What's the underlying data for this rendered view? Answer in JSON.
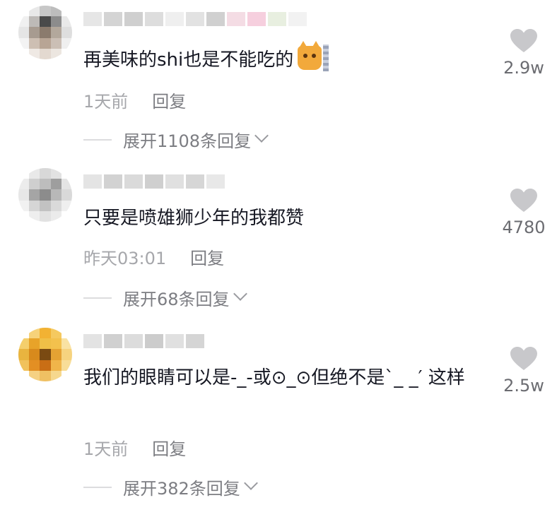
{
  "colors": {
    "text_primary": "#161823",
    "text_meta": "#a6a7ab",
    "text_action": "#7c7d82",
    "like_icon": "#c8c8cb"
  },
  "comments": [
    {
      "text": "再美味的shi也是不能吃的",
      "emoji": "cat-emoji-icon",
      "time": "1天前",
      "reply_label": "回复",
      "expand_label": "展开1108条回复",
      "likes": "2.9w",
      "avatar_colors": [
        "#ffffff",
        "#e8e8e8",
        "#c7c7c7",
        "#bdbdbd",
        "#ffffff",
        "#f0f0f0",
        "#bdbab7",
        "#4a4a4a",
        "#8c8c8c",
        "#e9e9e9",
        "#e5e5e5",
        "#a79b90",
        "#8b7b6d",
        "#b3a89c",
        "#dedede",
        "#f3f3f3",
        "#cdbfb3",
        "#b8a595",
        "#cbbfb5",
        "#efefef",
        "#ffffff",
        "#efe9e4",
        "#e3d9d0",
        "#ece6e0",
        "#ffffff"
      ],
      "name_colors": [
        "#e6e6e6",
        "#d4d4d4",
        "#cfcfcf",
        "#dddddd",
        "#efefef",
        "#e2e2e2",
        "#d0d0d0",
        "#f4dce4",
        "#f6cfde",
        "#e8efe0",
        "#f2f2f2"
      ]
    },
    {
      "text": "只要是喷雄狮少年的我都赞",
      "emoji": "",
      "time": "昨天03:01",
      "reply_label": "回复",
      "expand_label": "展开68条回复",
      "likes": "4780",
      "avatar_colors": [
        "#ffffff",
        "#e9e9e9",
        "#d8d8d8",
        "#e2e2e2",
        "#ffffff",
        "#ececec",
        "#cfcfcf",
        "#bdbdbd",
        "#9e9e9e",
        "#e4e4e4",
        "#e7e7e7",
        "#a5a5a5",
        "#8c8c8c",
        "#b8b8b8",
        "#d9d9d9",
        "#f1f1f1",
        "#d6d6d6",
        "#c2c2c2",
        "#dadada",
        "#efefef",
        "#ffffff",
        "#eeeeee",
        "#e2e2e2",
        "#ebebeb",
        "#ffffff"
      ],
      "name_colors": [
        "#e4e4e4",
        "#d2d2d2",
        "#dadada",
        "#cfcfcf",
        "#e0e0e0",
        "#d6d6d6",
        "#e8e8e8"
      ]
    },
    {
      "text": "我们的眼睛可以是-_-或⊙_⊙但绝不是`_ _′ 这样",
      "emoji": "",
      "time": "1天前",
      "reply_label": "回复",
      "expand_label": "展开382条回复",
      "likes": "2.5w",
      "avatar_colors": [
        "#ffffff",
        "#f6d27a",
        "#f2b233",
        "#f5c95f",
        "#ffffff",
        "#f4cf6c",
        "#e8a329",
        "#f0bf47",
        "#f3c14d",
        "#f9e2a3",
        "#e9b43f",
        "#d88a1c",
        "#7a4a12",
        "#e5a233",
        "#f6d37f",
        "#f1c25c",
        "#e38f23",
        "#c96e15",
        "#f0b54a",
        "#f8dd98",
        "#ffffff",
        "#f5d183",
        "#efc063",
        "#f6d88e",
        "#ffffff"
      ],
      "name_colors": [
        "#e3e3e3",
        "#d0d0d0",
        "#dcdcdc",
        "#cccccc",
        "#e0e0e0",
        "#d5d5d5"
      ]
    }
  ]
}
